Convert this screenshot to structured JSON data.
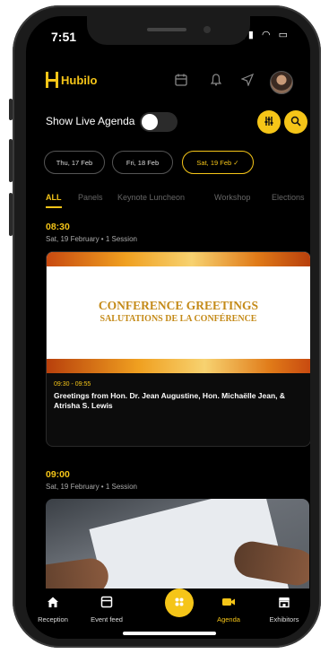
{
  "status": {
    "time": "7:51"
  },
  "app": {
    "brand": "Hubilo",
    "accent": "#f5c518"
  },
  "header_icons": [
    "calendar-icon",
    "bell-icon",
    "send-icon",
    "avatar"
  ],
  "live_agenda": {
    "label": "Show Live Agenda",
    "enabled": false
  },
  "dates": [
    {
      "label": "Thu, 17 Feb",
      "selected": false
    },
    {
      "label": "Fri, 18 Feb",
      "selected": false
    },
    {
      "label": "Sat, 19 Feb ✓",
      "selected": true
    }
  ],
  "tabs": [
    {
      "label": "ALL",
      "active": true
    },
    {
      "label": "Panels",
      "active": false
    },
    {
      "label": "Keynote Luncheon",
      "active": false
    },
    {
      "label": "Workshop",
      "active": false
    },
    {
      "label": "Elections",
      "active": false
    }
  ],
  "sections": [
    {
      "time": "08:30",
      "meta": "Sat, 19 February • 1 Session",
      "session": {
        "banner_title": "CONFERENCE GREETINGS",
        "banner_subtitle": "SALUTATIONS DE LA CONFÉRENCE",
        "time_range": "09:30 - 09:55",
        "title": "Greetings from Hon. Dr. Jean Augustine, Hon. Michaëlle Jean, & Atrisha S. Lewis"
      }
    },
    {
      "time": "09:00",
      "meta": "Sat, 19 February • 1 Session"
    }
  ],
  "bottom_nav": [
    {
      "label": "Reception",
      "icon": "home-icon"
    },
    {
      "label": "Event feed",
      "icon": "feed-icon"
    },
    {
      "label": "",
      "icon": "menu-grid-icon"
    },
    {
      "label": "Agenda",
      "icon": "video-camera-icon",
      "active": true
    },
    {
      "label": "Exhibitors",
      "icon": "store-icon"
    }
  ]
}
